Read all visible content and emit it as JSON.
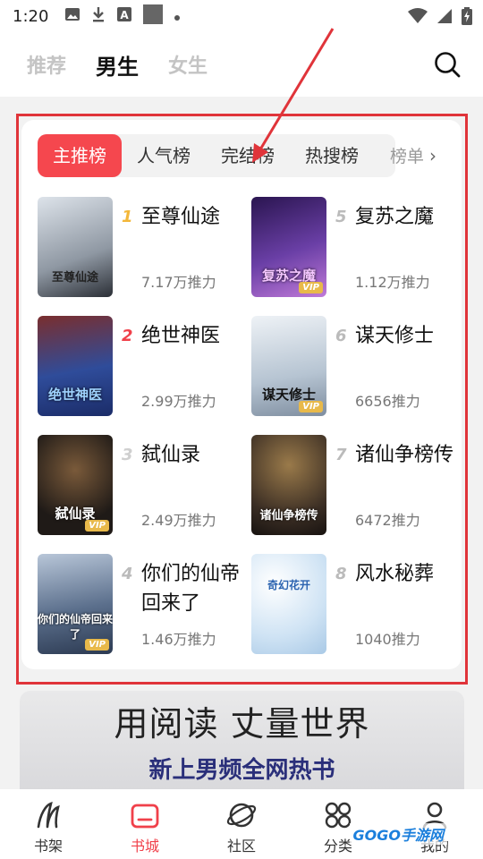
{
  "status_bar": {
    "time": "1:20"
  },
  "top_tabs": [
    {
      "label": "推荐"
    },
    {
      "label": "男生"
    },
    {
      "label": "女生"
    }
  ],
  "rank_tabs": [
    {
      "label": "主推榜"
    },
    {
      "label": "人气榜"
    },
    {
      "label": "完结榜"
    },
    {
      "label": "热搜榜"
    }
  ],
  "rank_more_label": "榜单",
  "books": [
    {
      "rank": "1",
      "title": "至尊仙途",
      "heat": "7.17万推力",
      "cover_text": "至尊仙途",
      "cover_color": "#b9c2cc"
    },
    {
      "rank": "2",
      "title": "绝世神医",
      "heat": "2.99万推力",
      "cover_text": "绝世神医",
      "cover_color": "#3d5aa8"
    },
    {
      "rank": "3",
      "title": "弑仙录",
      "heat": "2.49万推力",
      "cover_text": "弑仙录",
      "cover_color": "#2a2320"
    },
    {
      "rank": "4",
      "title": "你们的仙帝回来了",
      "heat": "1.46万推力",
      "cover_text": "你们的仙帝回来了",
      "cover_color": "#5b6f8c"
    },
    {
      "rank": "5",
      "title": "复苏之魔",
      "heat": "1.12万推力",
      "cover_text": "复苏之魔",
      "cover_color": "#5a3a8a"
    },
    {
      "rank": "6",
      "title": "谋天修士",
      "heat": "6656推力",
      "cover_text": "谋天修士",
      "cover_color": "#c9d3dc"
    },
    {
      "rank": "7",
      "title": "诸仙争榜传",
      "heat": "6472推力",
      "cover_text": "诸仙争榜传",
      "cover_color": "#3b2e24"
    },
    {
      "rank": "8",
      "title": "风水秘葬",
      "heat": "1040推力",
      "cover_text": "奇幻花开",
      "cover_color": "#cfe3f4"
    }
  ],
  "vip_label": "VIP",
  "banner": {
    "line1": "用阅读 丈量世界",
    "line2": "新上男频全网热书"
  },
  "bottom_nav": [
    {
      "label": "书架"
    },
    {
      "label": "书城"
    },
    {
      "label": "社区"
    },
    {
      "label": "分类"
    },
    {
      "label": "我的"
    }
  ],
  "watermark": "GOGO手游网",
  "colors": {
    "accent": "#f5474e",
    "highlight_frame": "#e0343a",
    "rank_gold": "#f3b73a"
  }
}
